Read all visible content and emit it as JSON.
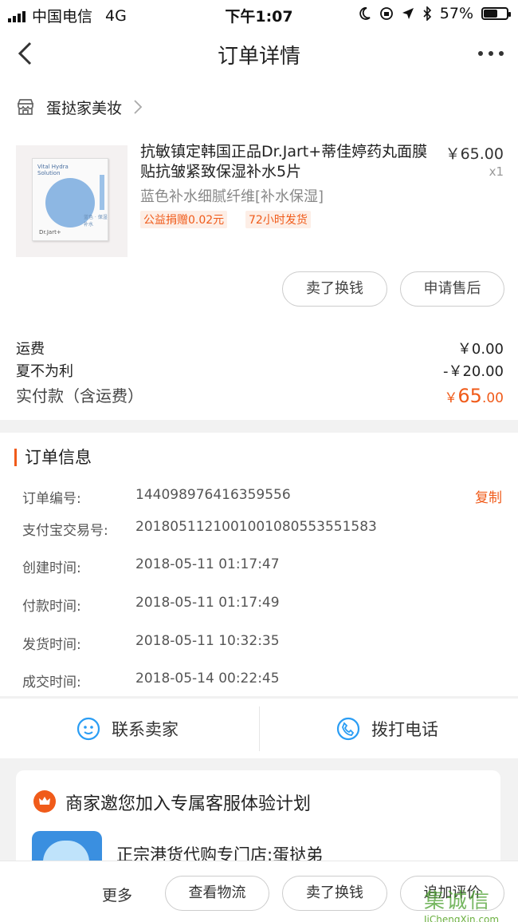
{
  "status_bar": {
    "carrier": "中国电信",
    "network": "4G",
    "time": "下午1:07",
    "battery": "57%"
  },
  "nav": {
    "title": "订单详情"
  },
  "shop": {
    "name": "蛋挞家美妆"
  },
  "product": {
    "name": "抗敏镇定韩国正品Dr.Jart+蒂佳婷药丸面膜贴抗皱紧致保湿补水5片",
    "price": "￥65.00",
    "quantity": "x1",
    "sku": "蓝色补水细腻纤维[补水保湿]",
    "tags": [
      "公益捐赠0.02元",
      "72小时发货"
    ],
    "image_text": {
      "title": "Vital Hydra Solution",
      "brand": "Dr.Jart+",
      "side": "蓝色 · 保湿补水"
    }
  },
  "item_actions": {
    "sell_label": "卖了换钱",
    "after_sale_label": "申请售后"
  },
  "fees": {
    "shipping_label": "运费",
    "shipping_value": "￥0.00",
    "discount_label": "夏不为利",
    "discount_value": "-￥20.00",
    "total_label": "实付款（含运费）",
    "total_currency": "￥",
    "total_int": "65",
    "total_dec": ".00"
  },
  "order_info": {
    "section_title": "订单信息",
    "copy_label": "复制",
    "rows": [
      {
        "label": "订单编号:",
        "value": "144098976416359556"
      },
      {
        "label": "支付宝交易号:",
        "value": "2018051121001001080553551583"
      },
      {
        "label": "创建时间:",
        "value": "2018-05-11 01:17:47"
      },
      {
        "label": "付款时间:",
        "value": "2018-05-11 01:17:49"
      },
      {
        "label": "发货时间:",
        "value": "2018-05-11 10:32:35"
      },
      {
        "label": "成交时间:",
        "value": "2018-05-14 00:22:45"
      }
    ]
  },
  "contact": {
    "seller_label": "联系卖家",
    "phone_label": "拨打电话"
  },
  "promo": {
    "title": "商家邀您加入专属客服体验计划",
    "store_name": "正宗港货代购专门店:蛋挞弟"
  },
  "bottom_bar": {
    "more_label": "更多",
    "buttons": [
      "查看物流",
      "卖了换钱",
      "追加评价"
    ]
  },
  "watermark": {
    "text": "JiChengXin.com",
    "big": "集诚信"
  },
  "colors": {
    "accent": "#f05b1a",
    "icon_blue": "#2a9df4"
  }
}
